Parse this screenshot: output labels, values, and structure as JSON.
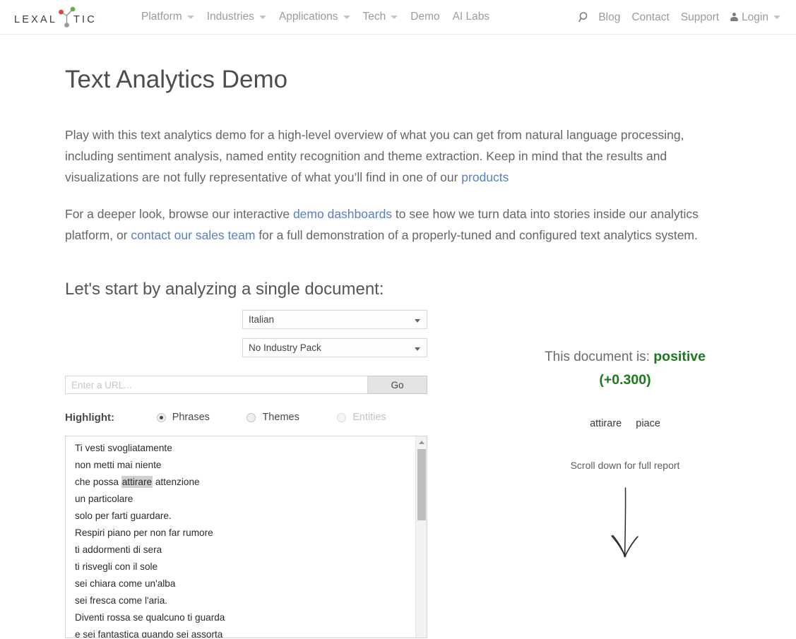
{
  "header": {
    "logo": {
      "text_left": "LEXAL",
      "text_right": "TICS",
      "dot_red": "#d7473a",
      "dot_green": "#6ab04c",
      "dot_gray": "#9a9a9a"
    },
    "main_nav": [
      {
        "label": "Platform",
        "has_caret": true
      },
      {
        "label": "Industries",
        "has_caret": true
      },
      {
        "label": "Applications",
        "has_caret": true
      },
      {
        "label": "Tech",
        "has_caret": true
      },
      {
        "label": "Demo",
        "has_caret": false
      },
      {
        "label": "AI Labs",
        "has_caret": false
      }
    ],
    "right_nav": {
      "search_icon": "search-icon",
      "items": [
        {
          "label": "Blog"
        },
        {
          "label": "Contact"
        },
        {
          "label": "Support"
        }
      ],
      "login": {
        "label": "Login",
        "icon": "person-icon",
        "has_caret": true
      }
    }
  },
  "main": {
    "title": "Text Analytics Demo",
    "paragraph1": {
      "part1": "Play with this text analytics demo for a high-level overview of what you can get from natural language processing, including sentiment analysis, named entity recognition and theme extraction. Keep in mind that the results and visualizations are not fully representative of what you’ll find in one of our ",
      "link1": "products"
    },
    "paragraph2": {
      "part1": "For a deeper look, browse our interactive ",
      "link1": "demo dashboards",
      "part2": " to see how we turn data into stories inside our analytics platform, or ",
      "link2": "contact our sales team",
      "part3": " for a full demonstration of a properly-tuned and configured text analytics system."
    },
    "section_title": "Let's start by analyzing a single document:"
  },
  "form": {
    "language_select": {
      "value": "Italian"
    },
    "industry_select": {
      "value": "No Industry Pack"
    },
    "url_input": {
      "placeholder": "Enter a URL...",
      "value": ""
    },
    "go_button": "Go",
    "highlight": {
      "label": "Highlight:",
      "options": [
        {
          "label": "Phrases",
          "checked": true,
          "disabled": false
        },
        {
          "label": "Themes",
          "checked": false,
          "disabled": false
        },
        {
          "label": "Entities",
          "checked": false,
          "disabled": true
        }
      ]
    },
    "document_lines": [
      {
        "text": "Ti vesti svogliatamente"
      },
      {
        "text": "non metti mai niente"
      },
      {
        "pre": "che possa ",
        "highlight": "attirare",
        "post": " attenzione"
      },
      {
        "text": "un particolare"
      },
      {
        "text": "solo per farti guardare."
      },
      {
        "text": "Respiri piano per non far rumore"
      },
      {
        "text": "ti addormenti di sera"
      },
      {
        "text": "ti risvegli con il sole"
      },
      {
        "text": "sei chiara come un'alba"
      },
      {
        "text": "sei fresca come l'aria."
      },
      {
        "text": "Diventi rossa se qualcuno ti guarda"
      },
      {
        "text": "e sei fantastica quando sei assorta"
      }
    ]
  },
  "results": {
    "verdict_prefix": "This document is:",
    "sentiment": "positive",
    "score": "(+0.300)",
    "sentiment_color": "#1a7a1a",
    "terms": [
      {
        "label": "attirare"
      },
      {
        "label": "piace"
      }
    ],
    "scroll_note": "Scroll down for full report"
  }
}
